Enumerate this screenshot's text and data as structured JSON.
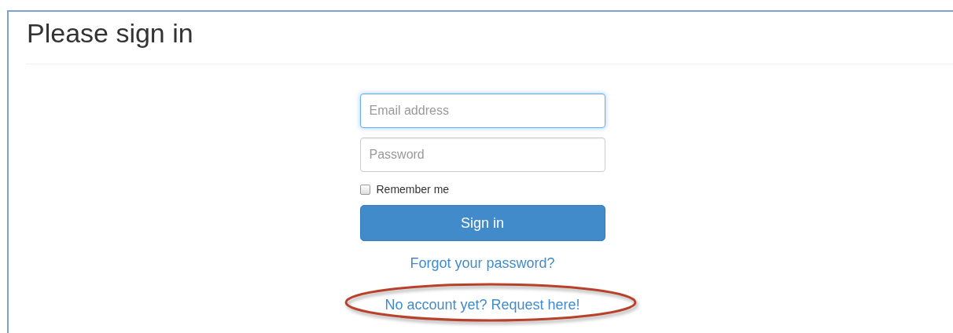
{
  "heading": "Please sign in",
  "fields": [
    {
      "placeholder": "Email address",
      "focused": true
    },
    {
      "placeholder": "Password",
      "focused": false
    }
  ],
  "remember": {
    "label": "Remember me",
    "checked": false
  },
  "submit": "Sign in",
  "links": [
    {
      "text": "Forgot your password?",
      "circled": false
    },
    {
      "text": "No account yet? Request here!",
      "circled": true
    }
  ]
}
